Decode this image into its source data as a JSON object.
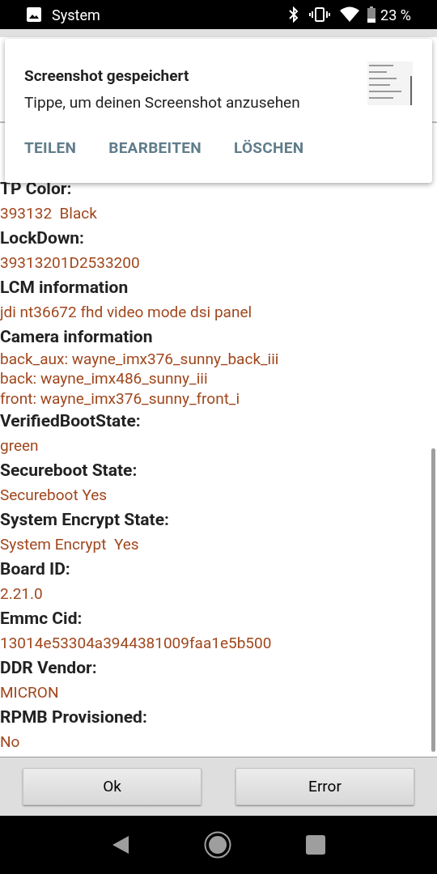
{
  "status_bar": {
    "app": "System",
    "battery": "23 %"
  },
  "notification": {
    "title": "Screenshot gespeichert",
    "text": "Tippe, um deinen Screenshot anzusehen",
    "actions": [
      "TEILEN",
      "BEARBEITEN",
      "LÖSCHEN"
    ]
  },
  "sections": [
    {
      "label": "TP Color:",
      "values": [
        "393132  Black"
      ]
    },
    {
      "label": "LockDown:",
      "values": [
        "39313201D2533200"
      ]
    },
    {
      "label": "LCM information",
      "values": [
        "jdi nt36672 fhd video mode dsi panel"
      ]
    },
    {
      "label": "Camera information",
      "values": [
        "back_aux: wayne_imx376_sunny_back_iii",
        "back: wayne_imx486_sunny_iii",
        "front: wayne_imx376_sunny_front_i"
      ]
    },
    {
      "label": "VerifiedBootState:",
      "values": [
        "green"
      ]
    },
    {
      "label": "Secureboot State:",
      "values": [
        "Secureboot Yes"
      ]
    },
    {
      "label": "System Encrypt State:",
      "values": [
        "System Encrypt  Yes"
      ]
    },
    {
      "label": "Board ID:",
      "values": [
        "2.21.0"
      ]
    },
    {
      "label": "Emmc Cid:",
      "values": [
        "13014e53304a3944381009faa1e5b500"
      ]
    },
    {
      "label": "DDR Vendor:",
      "values": [
        "MICRON"
      ]
    },
    {
      "label": "RPMB Provisioned:",
      "values": [
        "No"
      ]
    }
  ],
  "buttons": [
    "Ok",
    "Error"
  ]
}
